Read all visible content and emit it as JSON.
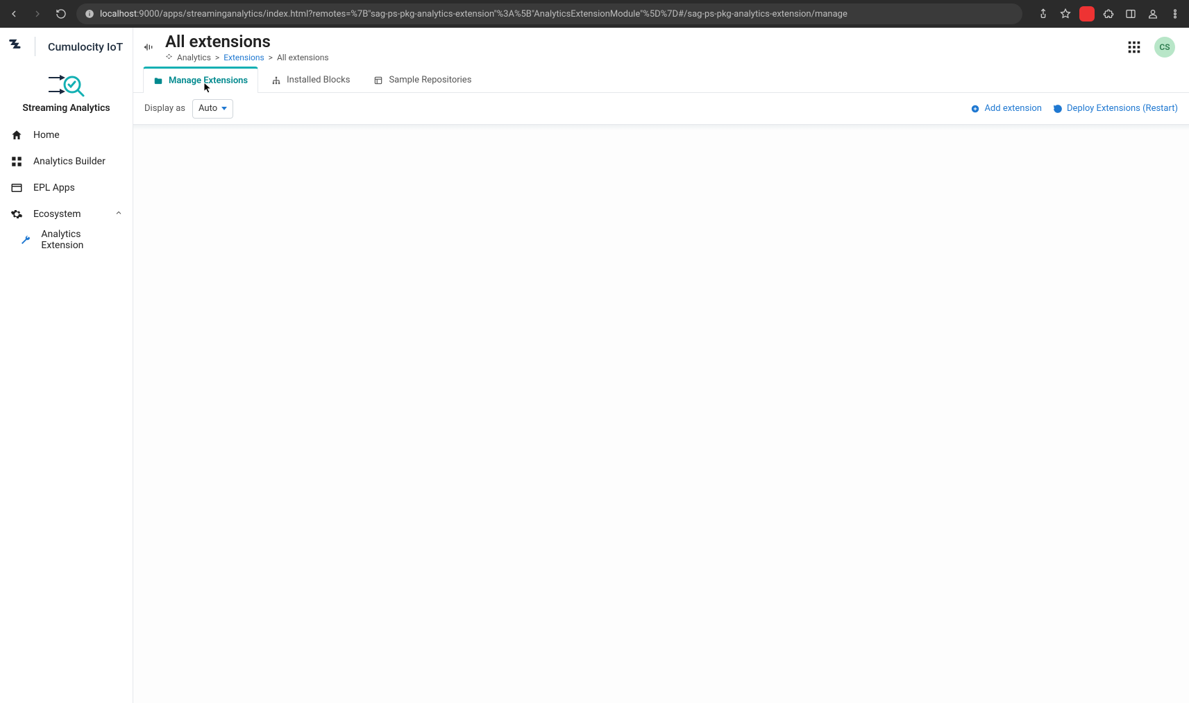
{
  "browser": {
    "url_host": "localhost",
    "url_rest": ":9000/apps/streaminganalytics/index.html?remotes=%7B\"sag-ps-pkg-analytics-extension\"%3A%5B\"AnalyticsExtensionModule\"%5D%7D#/sag-ps-pkg-analytics-extension/manage"
  },
  "brand": {
    "product": "Cumulocity IoT"
  },
  "app_identity": {
    "name": "Streaming Analytics"
  },
  "sidebar": {
    "items": [
      {
        "label": "Home"
      },
      {
        "label": "Analytics Builder"
      },
      {
        "label": "EPL Apps"
      },
      {
        "label": "Ecosystem",
        "expandable": true,
        "expanded": true,
        "children": [
          {
            "label": "Analytics Extension"
          }
        ]
      }
    ]
  },
  "header": {
    "title": "All extensions",
    "breadcrumb": {
      "root": "Analytics",
      "link": "Extensions",
      "current": "All extensions",
      "sep": ">"
    },
    "avatar_initials": "CS"
  },
  "tabs": [
    {
      "label": "Manage Extensions",
      "active": true
    },
    {
      "label": "Installed Blocks"
    },
    {
      "label": "Sample Repositories"
    }
  ],
  "toolbar": {
    "display_as_label": "Display as",
    "display_as_value": "Auto",
    "add_extension": "Add extension",
    "deploy": "Deploy Extensions (Restart)"
  }
}
